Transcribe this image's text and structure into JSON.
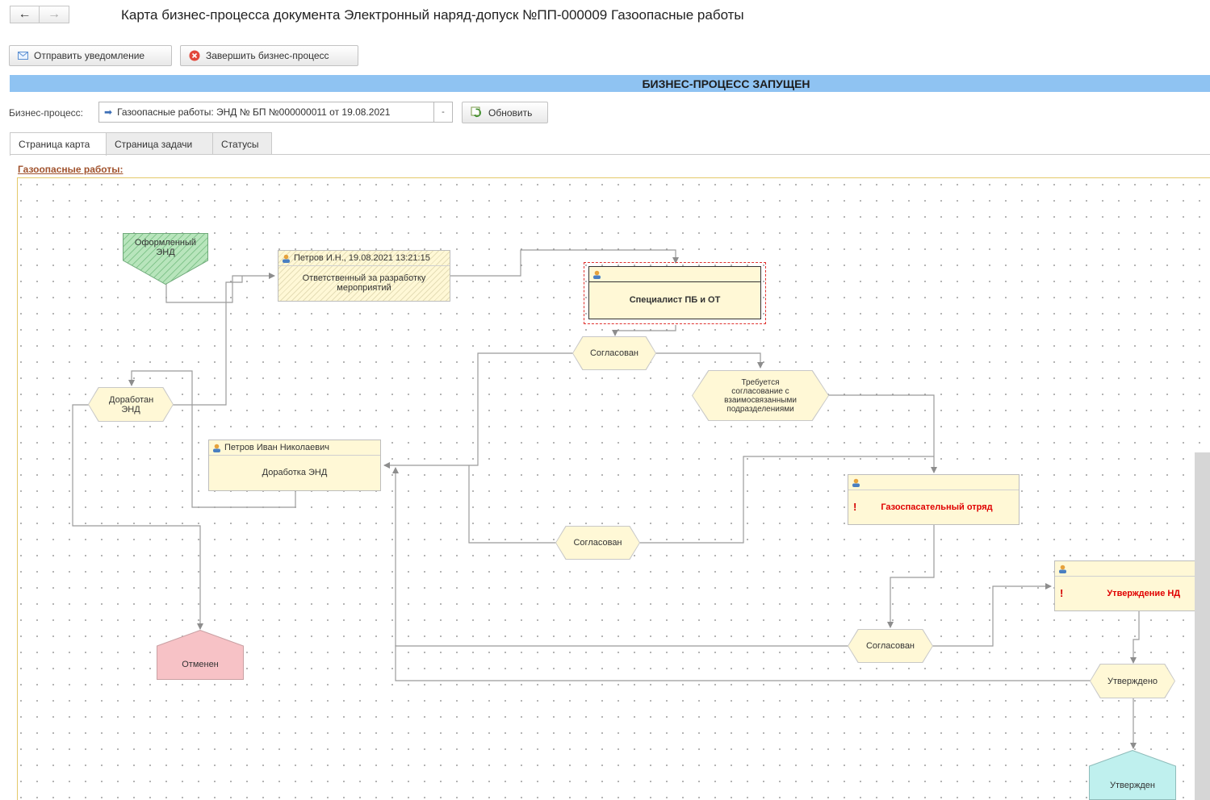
{
  "window": {
    "title": "Карта бизнес-процесса документа Электронный наряд-допуск №ПП-000009 Газоопасные работы"
  },
  "toolbar": {
    "notify_label": "Отправить уведомление",
    "finish_label": "Завершить бизнес-процесс",
    "refresh_label": "Обновить"
  },
  "banner": "БИЗНЕС-ПРОЦЕСС ЗАПУЩЕН",
  "process": {
    "label": "Бизнес-процесс:",
    "value": "Газоопасные работы: ЭНД № БП №000000011 от 19.08.2021"
  },
  "tabs": [
    {
      "label": "Страница карта",
      "active": true
    },
    {
      "label": "Страница задачи",
      "active": false
    },
    {
      "label": "Статусы",
      "active": false
    }
  ],
  "map": {
    "title": "Газоопасные работы:",
    "start": "Оформленный ЭНД",
    "task_responsible": {
      "header": "Петров И.Н., 19.08.2021 13:21:15",
      "body": "Ответственный за разработку мероприятий"
    },
    "task_specialist": {
      "header": "",
      "body": "Специалист ПБ и ОТ"
    },
    "cond_agreed_1": "Согласован",
    "cond_required": "Требуется согласование с взаимосвязанными подразделениями",
    "cond_revised": "Доработан ЭНД",
    "task_revision": {
      "header": "Петров Иван Николаевич",
      "body": "Доработка ЭНД"
    },
    "task_gas_rescue": {
      "body": "Газоспасательный отряд"
    },
    "cond_agreed_2": "Согласован",
    "task_approval": {
      "body": "Утверждение НД"
    },
    "cond_agreed_3": "Согласован",
    "cond_approved": "Утверждено",
    "end_cancelled": "Отменен",
    "end_approved": "Утвержден"
  },
  "colors": {
    "banner": "#8fc3f2",
    "task_fill": "#fff8d6",
    "start_fill": "#a8dcae",
    "cancel_fill": "#f7c2c6",
    "approved_fill": "#bff0ee",
    "accent_red": "#e00000"
  }
}
